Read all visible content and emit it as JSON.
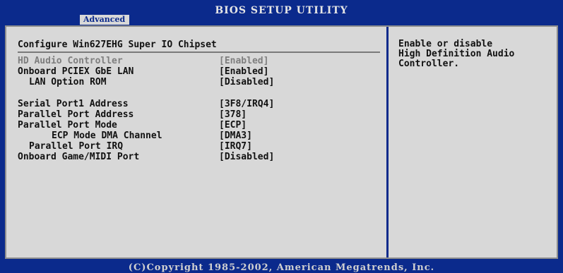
{
  "header": {
    "title": "BIOS SETUP UTILITY",
    "active_tab": "Advanced"
  },
  "main": {
    "section_title": "Configure Win627EHG Super IO Chipset",
    "items": [
      {
        "label": "HD Audio Controller",
        "value": "[Enabled]"
      },
      {
        "label": "Onboard PCIEX GbE LAN",
        "value": "[Enabled]"
      },
      {
        "label": "LAN Option ROM",
        "value": "[Disabled]"
      },
      {
        "label": "Serial Port1 Address",
        "value": "[3F8/IRQ4]"
      },
      {
        "label": "Parallel Port Address",
        "value": "[378]"
      },
      {
        "label": "Parallel Port Mode",
        "value": "[ECP]"
      },
      {
        "label": "ECP Mode DMA Channel",
        "value": "[DMA3]"
      },
      {
        "label": "Parallel Port IRQ",
        "value": "[IRQ7]"
      },
      {
        "label": "Onboard Game/MIDI Port",
        "value": "[Disabled]"
      }
    ]
  },
  "help": {
    "text": "Enable or disable\nHigh Definition Audio\nController."
  },
  "footer": {
    "copyright": "(C)Copyright 1985-2002, American Megatrends, Inc."
  },
  "colors": {
    "background": "#0b2a8c",
    "panel": "#d8d8d8",
    "selected_text": "#7e7e7e",
    "text": "#111111"
  }
}
